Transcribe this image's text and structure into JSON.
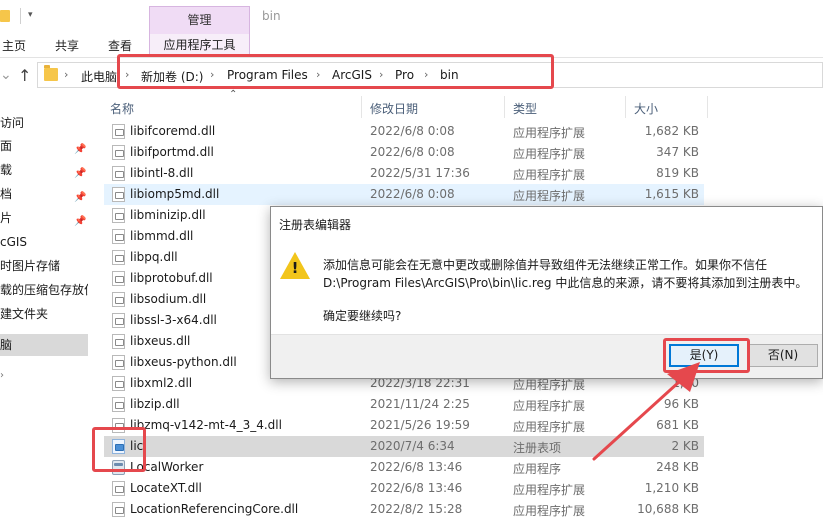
{
  "window": {
    "manage_tab": "管理",
    "title": "bin"
  },
  "ribbon": {
    "tabs": [
      "主页",
      "共享",
      "查看",
      "应用程序工具"
    ]
  },
  "address": {
    "crumbs": [
      "此电脑",
      "新加卷 (D:)",
      "Program Files",
      "ArcGIS",
      "Pro",
      "bin"
    ]
  },
  "nav": {
    "items": [
      "访问",
      "面",
      "载",
      "档",
      "片",
      "cGIS",
      "时图片存储",
      "载的压缩包存放位",
      "建文件夹",
      "脑"
    ]
  },
  "columns": {
    "name": "名称",
    "date": "修改日期",
    "type": "类型",
    "size": "大小"
  },
  "files": [
    {
      "name": "libifcoremd.dll",
      "date": "2022/6/8 0:08",
      "type": "应用程序扩展",
      "size": "1,682 KB"
    },
    {
      "name": "libifportmd.dll",
      "date": "2022/6/8 0:08",
      "type": "应用程序扩展",
      "size": "347 KB"
    },
    {
      "name": "libintl-8.dll",
      "date": "2022/5/31 17:36",
      "type": "应用程序扩展",
      "size": "819 KB"
    },
    {
      "name": "libiomp5md.dll",
      "date": "2022/6/8 0:08",
      "type": "应用程序扩展",
      "size": "1,615 KB"
    },
    {
      "name": "libminizip.dll",
      "date": "",
      "type": "",
      "size": ""
    },
    {
      "name": "libmmd.dll",
      "date": "",
      "type": "",
      "size": ""
    },
    {
      "name": "libpq.dll",
      "date": "",
      "type": "",
      "size": ""
    },
    {
      "name": "libprotobuf.dll",
      "date": "",
      "type": "",
      "size": ""
    },
    {
      "name": "libsodium.dll",
      "date": "",
      "type": "",
      "size": ""
    },
    {
      "name": "libssl-3-x64.dll",
      "date": "",
      "type": "",
      "size": ""
    },
    {
      "name": "libxeus.dll",
      "date": "",
      "type": "",
      "size": ""
    },
    {
      "name": "libxeus-python.dll",
      "date": "",
      "type": "",
      "size": ""
    },
    {
      "name": "libxml2.dll",
      "date": "2022/3/18 22:31",
      "type": "应用程序扩展",
      "size": "1,40"
    },
    {
      "name": "libzip.dll",
      "date": "2021/11/24 2:25",
      "type": "应用程序扩展",
      "size": "96 KB"
    },
    {
      "name": "libzmq-v142-mt-4_3_4.dll",
      "date": "2021/5/26 19:59",
      "type": "应用程序扩展",
      "size": "681 KB"
    },
    {
      "name": "lic",
      "date": "2020/7/4 6:34",
      "type": "注册表项",
      "size": "2 KB"
    },
    {
      "name": "LocalWorker",
      "date": "2022/6/8 13:46",
      "type": "应用程序",
      "size": "248 KB"
    },
    {
      "name": "LocateXT.dll",
      "date": "2022/6/8 13:46",
      "type": "应用程序扩展",
      "size": "1,210 KB"
    },
    {
      "name": "LocationReferencingCore.dll",
      "date": "2022/8/2 15:28",
      "type": "应用程序扩展",
      "size": "10,688 KB"
    }
  ],
  "dialog": {
    "title": "注册表编辑器",
    "line1": "添加信息可能会在无意中更改或删除值并导致组件无法继续正常工作。如果你不信任",
    "line2": "D:\\Program Files\\ArcGIS\\Pro\\bin\\lic.reg 中此信息的来源，请不要将其添加到注册表中。",
    "line3": "确定要继续吗?",
    "yes_label": "是(Y)",
    "no_label": "否(N)"
  },
  "colors": {
    "annotation_red": "#e5484d",
    "manage_tab_bg": "#f0dcf5",
    "selection_blue": "#e5f3ff",
    "default_button_border": "#0078d7",
    "warning_yellow": "#f2c51b"
  }
}
